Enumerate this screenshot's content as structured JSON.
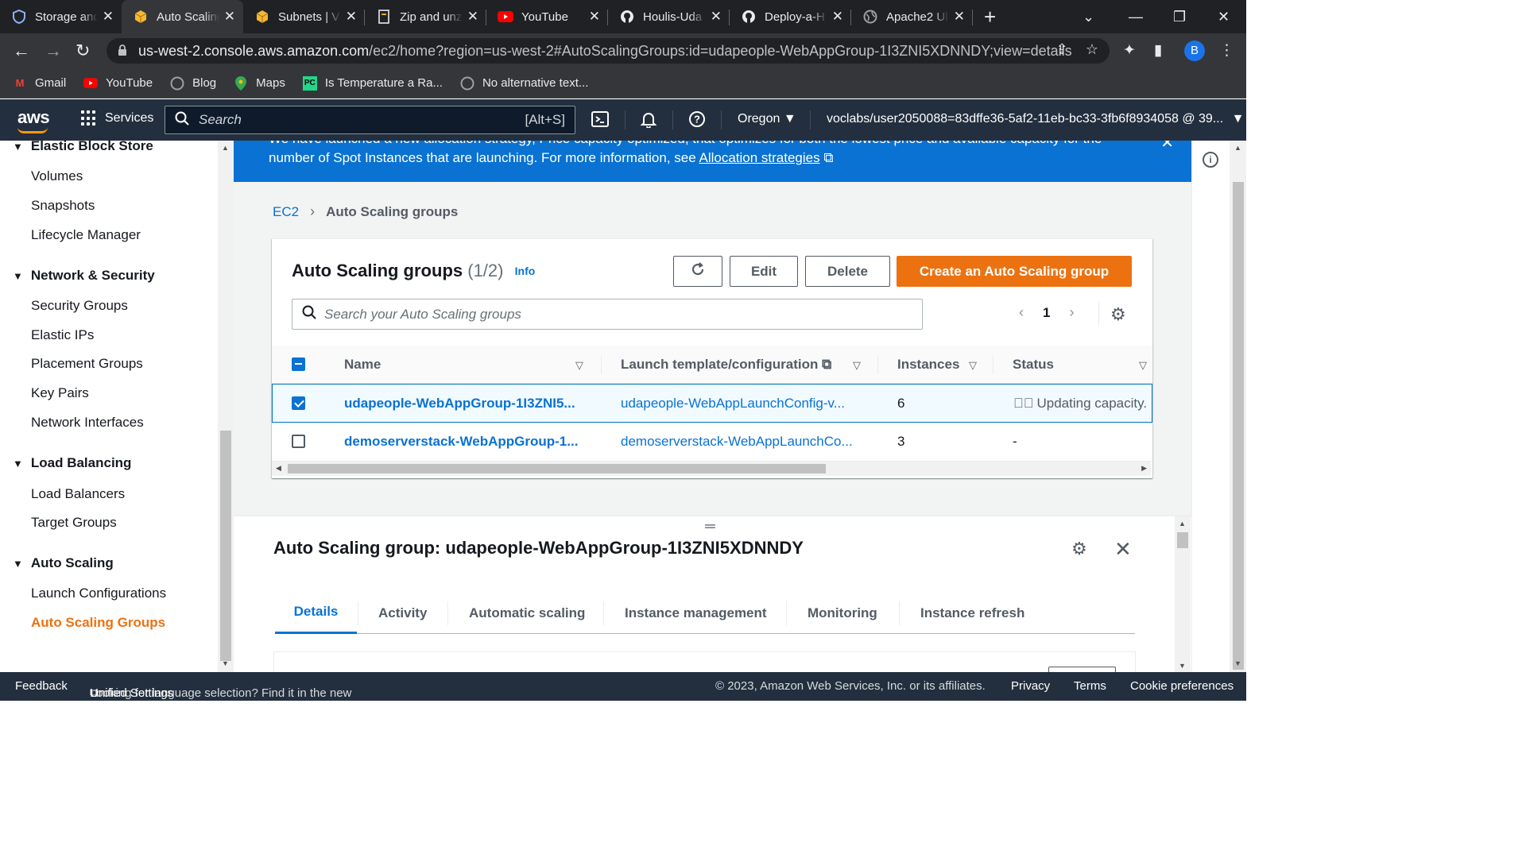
{
  "browser": {
    "tabs": [
      {
        "title": "Storage and",
        "icon": "shield-icon"
      },
      {
        "title": "Auto Scaling",
        "icon": "aws-cube-icon",
        "active": true
      },
      {
        "title": "Subnets | V",
        "icon": "aws-cube-icon"
      },
      {
        "title": "Zip and unz",
        "icon": "page-icon"
      },
      {
        "title": "YouTube",
        "icon": "youtube-icon"
      },
      {
        "title": "Houlis-Uda",
        "icon": "github-icon"
      },
      {
        "title": "Deploy-a-H",
        "icon": "github-icon"
      },
      {
        "title": "Apache2 Ul",
        "icon": "globe-icon"
      }
    ],
    "url_host": "us-west-2.console.aws.amazon.com",
    "url_path": "/ec2/home?region=us-west-2#AutoScalingGroups:id=udapeople-WebAppGroup-1I3ZNI5XDNNDY;view=details",
    "profile_initial": "B",
    "bookmarks": [
      {
        "label": "Gmail",
        "icon": "gmail-icon"
      },
      {
        "label": "YouTube",
        "icon": "youtube-icon"
      },
      {
        "label": "Blog",
        "icon": "globe-icon"
      },
      {
        "label": "Maps",
        "icon": "maps-pin-icon"
      },
      {
        "label": "Is Temperature a Ra...",
        "icon": "pycharm-icon"
      },
      {
        "label": "No alternative text...",
        "icon": "globe-icon"
      }
    ]
  },
  "aws_nav": {
    "logo": "aws",
    "services_label": "Services",
    "search_placeholder": "Search",
    "search_shortcut": "[Alt+S]",
    "region": "Oregon",
    "account": "voclabs/user2050088=83dffe36-5af2-11eb-bc33-3fb6f8934058 @ 39..."
  },
  "sidebar": {
    "sections": [
      {
        "title": "Elastic Block Store",
        "items": [
          "Volumes",
          "Snapshots",
          "Lifecycle Manager"
        ]
      },
      {
        "title": "Network & Security",
        "items": [
          "Security Groups",
          "Elastic IPs",
          "Placement Groups",
          "Key Pairs",
          "Network Interfaces"
        ]
      },
      {
        "title": "Load Balancing",
        "items": [
          "Load Balancers",
          "Target Groups"
        ]
      },
      {
        "title": "Auto Scaling",
        "items": [
          "Launch Configurations",
          "Auto Scaling Groups"
        ]
      }
    ],
    "active_item": "Auto Scaling Groups"
  },
  "flash": {
    "line1": "We have launched a new allocation strategy, Price capacity optimized, that optimizes for both the lowest price and available capacity for the",
    "line2": "number of Spot Instances that are launching. For more information, see",
    "link": "Allocation strategies"
  },
  "breadcrumb": {
    "root": "EC2",
    "current": "Auto Scaling groups"
  },
  "groups_panel": {
    "title": "Auto Scaling groups",
    "count": "(1/2)",
    "info": "Info",
    "edit": "Edit",
    "delete": "Delete",
    "create": "Create an Auto Scaling group",
    "search_placeholder": "Search your Auto Scaling groups",
    "page": "1",
    "columns": {
      "name": "Name",
      "launch": "Launch template/configuration",
      "instances": "Instances",
      "status": "Status"
    },
    "rows": [
      {
        "name": "udapeople-WebAppGroup-1I3ZNI5...",
        "launch": "udapeople-WebAppLaunchConfig-v...",
        "instances": "6",
        "status": "Updating capacity.",
        "selected": true
      },
      {
        "name": "demoserverstack-WebAppGroup-1...",
        "launch": "demoserverstack-WebAppLaunchCo...",
        "instances": "3",
        "status": "-",
        "selected": false
      }
    ]
  },
  "details": {
    "title": "Auto Scaling group: udapeople-WebAppGroup-1I3ZNI5XDNNDY",
    "tabs": [
      "Details",
      "Activity",
      "Automatic scaling",
      "Instance management",
      "Monitoring",
      "Instance refresh"
    ],
    "active_tab": "Details"
  },
  "footer": {
    "feedback": "Feedback",
    "lang_prefix": "Looking for language selection? Find it in the new",
    "lang_link": "Unified Settings",
    "copyright": "© 2023, Amazon Web Services, Inc. or its affiliates.",
    "privacy": "Privacy",
    "terms": "Terms",
    "cookies": "Cookie preferences"
  },
  "colors": {
    "aws_orange": "#ec7211",
    "aws_blue": "#0972d3",
    "nav_bg": "#232f3e"
  }
}
